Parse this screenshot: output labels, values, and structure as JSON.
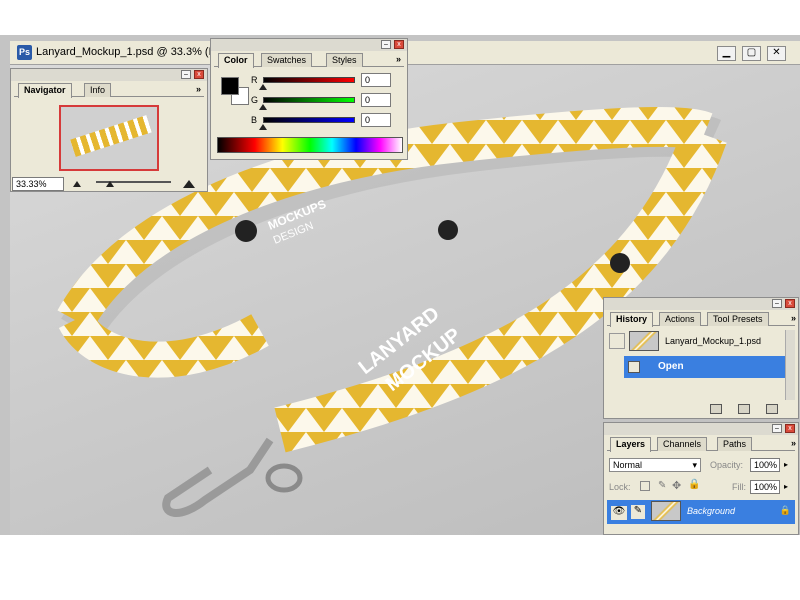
{
  "document": {
    "title": "Lanyard_Mockup_1.psd @ 33.3% (R"
  },
  "navigator": {
    "tabs": [
      "Navigator",
      "Info"
    ],
    "zoom": "33.33%"
  },
  "color": {
    "tabs": [
      "Color",
      "Swatches",
      "Styles"
    ],
    "channels": [
      {
        "label": "R",
        "value": "0"
      },
      {
        "label": "G",
        "value": "0"
      },
      {
        "label": "B",
        "value": "0"
      }
    ],
    "foreground": "#000000",
    "background": "#ffffff"
  },
  "history": {
    "tabs": [
      "History",
      "Actions",
      "Tool Presets"
    ],
    "snapshot": "Lanyard_Mockup_1.psd",
    "state": "Open"
  },
  "layers": {
    "tabs": [
      "Layers",
      "Channels",
      "Paths"
    ],
    "blend_mode": "Normal",
    "opacity_label": "Opacity:",
    "opacity": "100%",
    "lock_label": "Lock:",
    "fill_label": "Fill:",
    "fill": "100%",
    "layer_name": "Background"
  },
  "artwork": {
    "strap_texts": [
      "LANYARD",
      "MOCKUP",
      "MOCKUPS",
      "DESIGN"
    ]
  }
}
